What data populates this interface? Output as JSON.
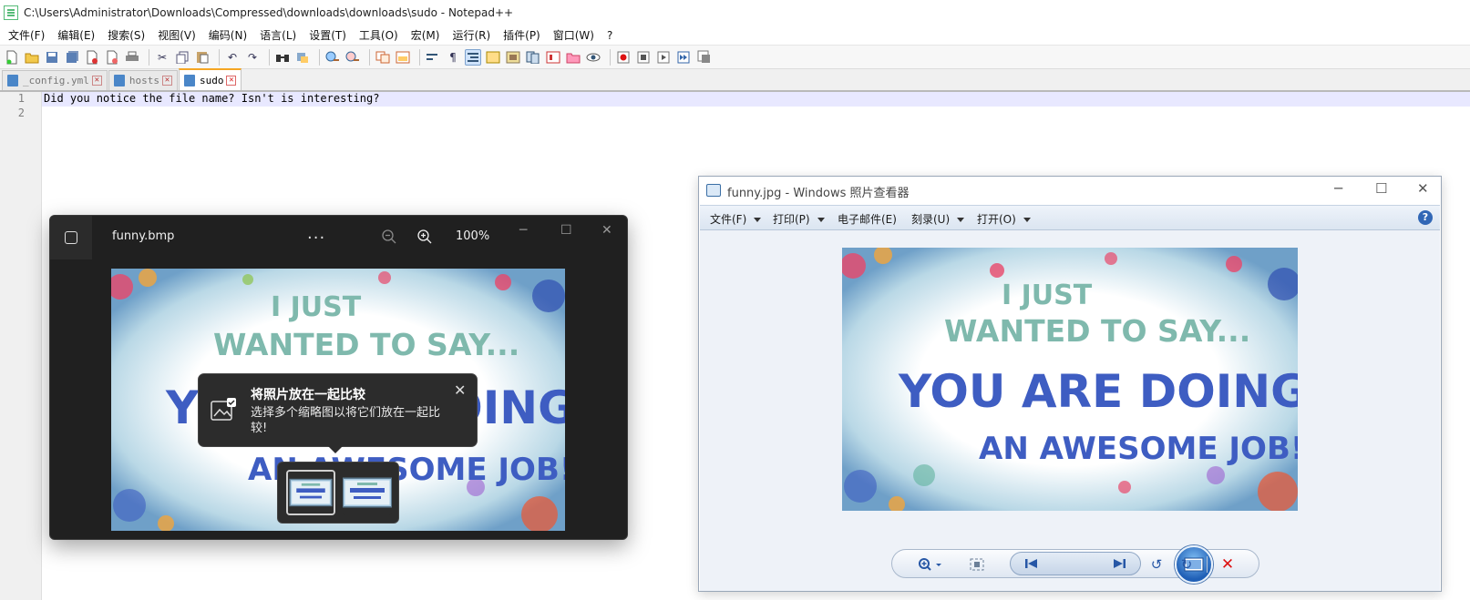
{
  "npp": {
    "title": "C:\\Users\\Administrator\\Downloads\\Compressed\\downloads\\downloads\\sudo - Notepad++",
    "menu": [
      "文件(F)",
      "编辑(E)",
      "搜索(S)",
      "视图(V)",
      "编码(N)",
      "语言(L)",
      "设置(T)",
      "工具(O)",
      "宏(M)",
      "运行(R)",
      "插件(P)",
      "窗口(W)",
      "?"
    ],
    "tabs": [
      {
        "label": "_config.yml",
        "active": false
      },
      {
        "label": "hosts",
        "active": false
      },
      {
        "label": "sudo",
        "active": true
      }
    ],
    "line_numbers": [
      "1",
      "2"
    ],
    "lines": [
      "Did you notice the file name? Isn't is interesting?",
      ""
    ]
  },
  "photos": {
    "file_name": "funny.bmp",
    "more_label": "...",
    "zoom": "100%",
    "tooltip_title": "将照片放在一起比较",
    "tooltip_body": "选择多个缩略图以将它们放在一起比较!"
  },
  "card": {
    "line1": "I JUST",
    "line2": "WANTED TO SAY...",
    "line3": "YOU ARE DOING",
    "line4": "AN AWESOME JOB!",
    "colors": {
      "teal": "#7fb9ad",
      "blue": "#3e5dc2"
    }
  },
  "wpv": {
    "title": "funny.jpg - Windows 照片查看器",
    "menu": [
      "文件(F)",
      "打印(P)",
      "电子邮件(E)",
      "刻录(U)",
      "打开(O)"
    ],
    "help_label": "?"
  }
}
